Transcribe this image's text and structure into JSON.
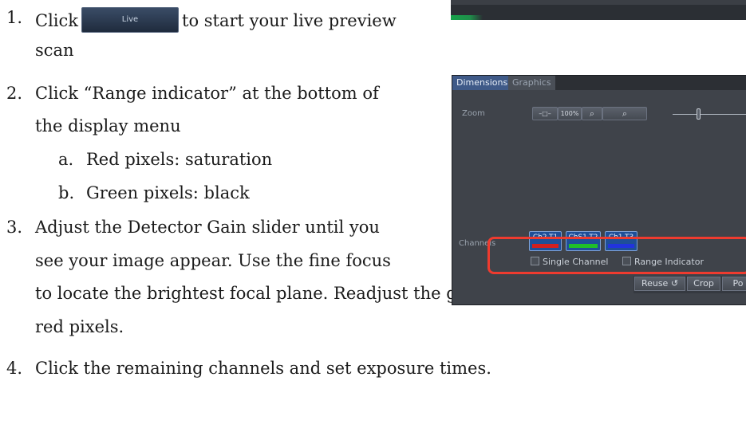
{
  "steps": [
    {
      "num": "1.",
      "before": "Click",
      "button_label": "Live",
      "after": "to start your live preview",
      "cont": "scan"
    },
    {
      "num": "2.",
      "line1": "Click “Range indicator”  at the bottom of",
      "line2": "the display menu"
    },
    {
      "num": "3.",
      "line1": "Adjust the Detector Gain slider until you",
      "line2": "see your image appear. Use the fine focus",
      "line3": "to locate the brightest focal plane. Readjust the gain until you see only a few",
      "line4": "red pixels."
    },
    {
      "num": "4.",
      "line1": "Click the remaining channels and set exposure times."
    }
  ],
  "substeps": [
    {
      "letter": "a.",
      "text": "Red pixels: saturation"
    },
    {
      "letter": "b.",
      "text": "Green pixels: black"
    }
  ],
  "panel": {
    "tabs": [
      "Dimensions",
      "Graphics"
    ],
    "zoom_label": "Zoom",
    "zoom_buttons": [
      "–□–",
      "100%",
      "⌕",
      "⌕"
    ],
    "channels_label": "Channels",
    "channel_buttons": [
      {
        "label": "Ch2-T1",
        "color": "#d21f1f"
      },
      {
        "label": "ChS1-T2",
        "color": "#1fbf2a"
      },
      {
        "label": "Ch1-T3",
        "color": "#2233dd"
      }
    ],
    "single_channel": "Single Channel",
    "range_indicator": "Range Indicator",
    "bottom_buttons": [
      "Reuse ↺",
      "Crop",
      "Po"
    ]
  },
  "colors": {
    "highlight": "#ee3b2f",
    "panel_bg": "#3f434a",
    "tab_active": "#3f5a88"
  }
}
